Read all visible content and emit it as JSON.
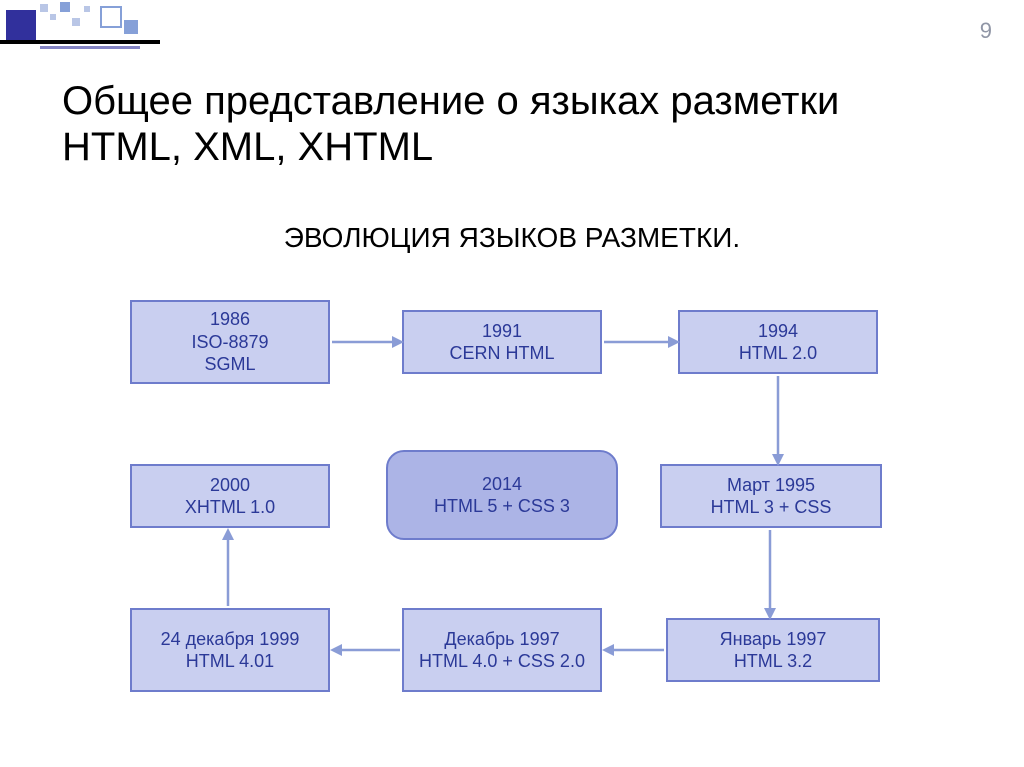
{
  "slide_number": "9",
  "title": "Общее представление о языках разметки HTML, XML, XHTML",
  "subtitle": "ЭВОЛЮЦИЯ ЯЗЫКОВ РАЗМЕТКИ.",
  "nodes": {
    "n1": "1986\nISO-8879\nSGML",
    "n2": "1991\nCERN HTML",
    "n3": "1994\nHTML 2.0",
    "n4": "2000\nXHTML 1.0",
    "n5": "2014\nHTML 5 + CSS 3",
    "n6": "Март 1995\nHTML 3 +  CSS",
    "n7": "24 декабря 1999\nHTML 4.01",
    "n8": "Декабрь 1997\nHTML 4.0 + CSS 2.0",
    "n9": "Январь 1997\nHTML 3.2"
  },
  "chart_data": {
    "type": "flow-diagram",
    "title": "Эволюция языков разметки",
    "nodes": [
      {
        "id": "n1",
        "label": "1986 ISO-8879 SGML"
      },
      {
        "id": "n2",
        "label": "1991 CERN HTML"
      },
      {
        "id": "n3",
        "label": "1994 HTML 2.0"
      },
      {
        "id": "n6",
        "label": "Март 1995 HTML 3 + CSS"
      },
      {
        "id": "n9",
        "label": "Январь 1997 HTML 3.2"
      },
      {
        "id": "n8",
        "label": "Декабрь 1997 HTML 4.0 + CSS 2.0"
      },
      {
        "id": "n7",
        "label": "24 декабря 1999 HTML 4.01"
      },
      {
        "id": "n4",
        "label": "2000 XHTML 1.0"
      },
      {
        "id": "n5",
        "label": "2014 HTML 5 + CSS 3",
        "highlight": true
      }
    ],
    "edges": [
      {
        "from": "n1",
        "to": "n2"
      },
      {
        "from": "n2",
        "to": "n3"
      },
      {
        "from": "n3",
        "to": "n6"
      },
      {
        "from": "n6",
        "to": "n9"
      },
      {
        "from": "n9",
        "to": "n8"
      },
      {
        "from": "n8",
        "to": "n7"
      },
      {
        "from": "n7",
        "to": "n4"
      }
    ]
  }
}
